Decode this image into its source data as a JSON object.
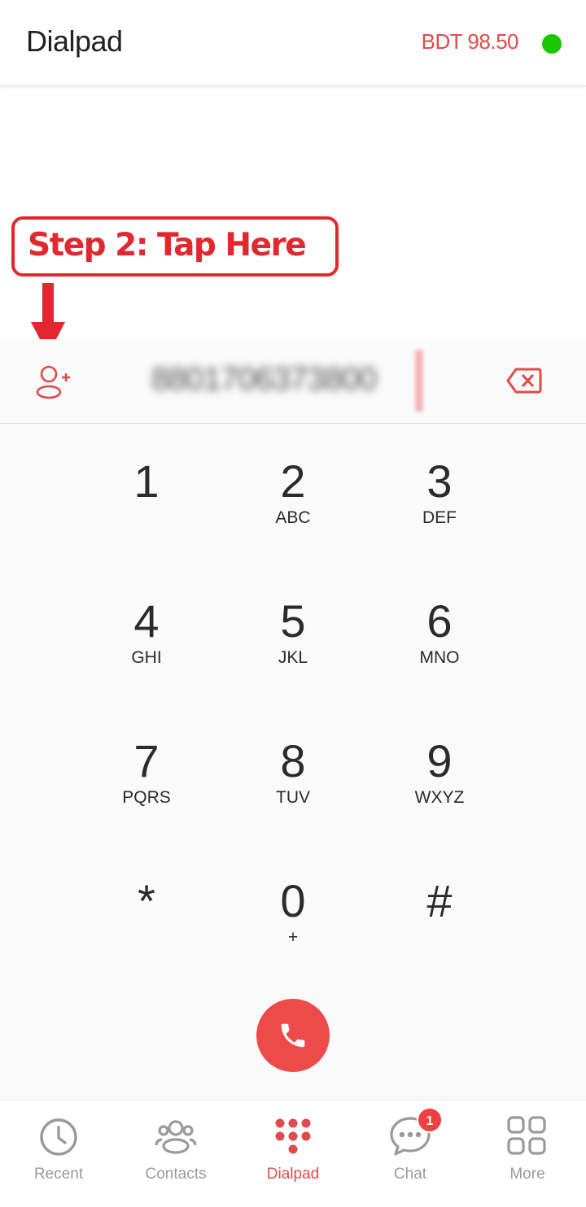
{
  "header": {
    "title": "Dialpad",
    "balance": "BDT 98.50",
    "status_color": "#18c800"
  },
  "annotation": {
    "callout_text": "Step 2: Tap Here"
  },
  "number_bar": {
    "value": "8801706373800",
    "add_contact_icon": "add-contact-icon",
    "backspace_icon": "backspace-icon"
  },
  "keypad": {
    "keys": [
      {
        "digit": "1",
        "letters": ""
      },
      {
        "digit": "2",
        "letters": "ABC"
      },
      {
        "digit": "3",
        "letters": "DEF"
      },
      {
        "digit": "4",
        "letters": "GHI"
      },
      {
        "digit": "5",
        "letters": "JKL"
      },
      {
        "digit": "6",
        "letters": "MNO"
      },
      {
        "digit": "7",
        "letters": "PQRS"
      },
      {
        "digit": "8",
        "letters": "TUV"
      },
      {
        "digit": "9",
        "letters": "WXYZ"
      },
      {
        "digit": "*",
        "letters": ""
      },
      {
        "digit": "0",
        "letters": "+"
      },
      {
        "digit": "#",
        "letters": ""
      }
    ]
  },
  "call": {
    "icon": "phone-icon",
    "color": "#ee4a4a"
  },
  "bottom_nav": {
    "items": [
      {
        "label": "Recent",
        "icon": "clock-icon"
      },
      {
        "label": "Contacts",
        "icon": "contacts-icon"
      },
      {
        "label": "Dialpad",
        "icon": "dialpad-icon",
        "active": true
      },
      {
        "label": "Chat",
        "icon": "chat-icon",
        "badge": "1"
      },
      {
        "label": "More",
        "icon": "grid-icon"
      }
    ]
  },
  "colors": {
    "accent": "#e04a4a",
    "annotation": "#e0282e"
  }
}
